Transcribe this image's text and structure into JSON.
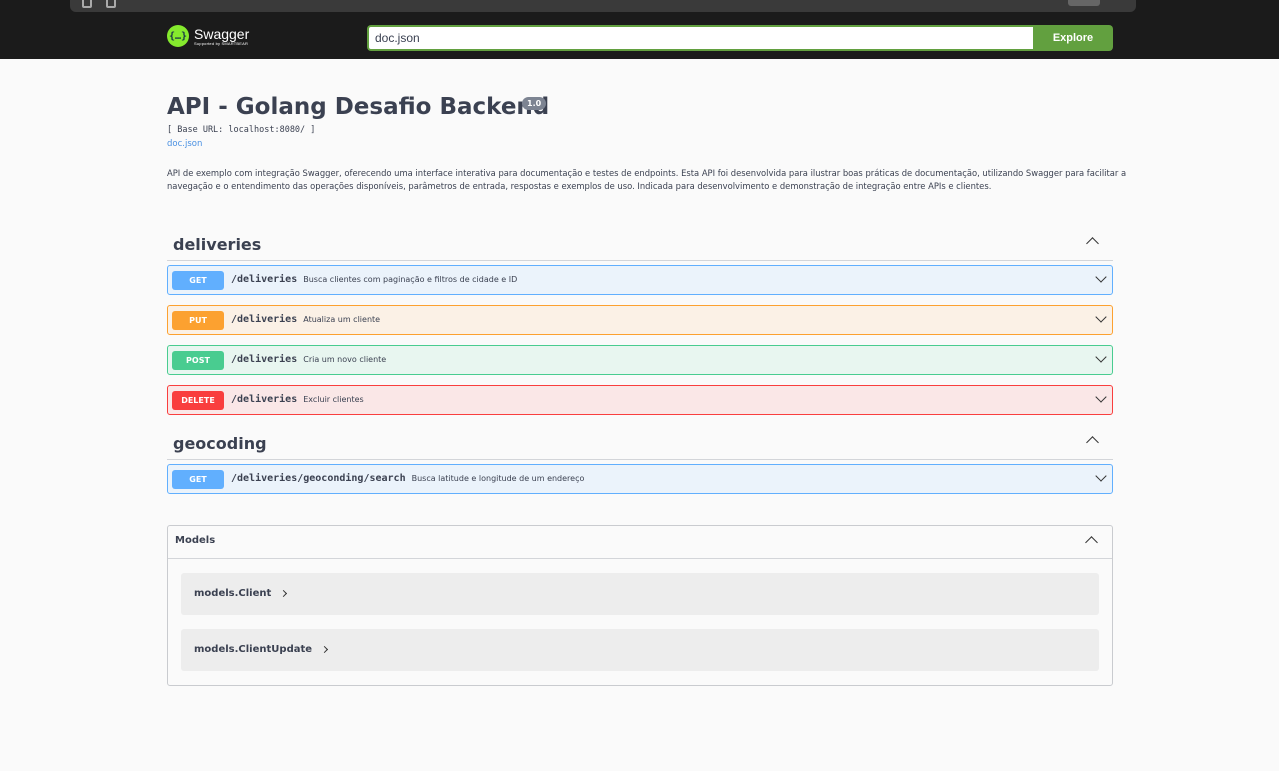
{
  "topbar": {
    "logo_name": "Swagger",
    "logo_sub": "Supported by SMARTBEAR",
    "url_value": "doc.json",
    "explore_label": "Explore"
  },
  "info": {
    "title": "API - Golang Desafio Backend",
    "version": "1.0",
    "base_url": "[ Base URL: localhost:8080/ ]",
    "doc_link": "doc.json",
    "description": "API de exemplo com integração Swagger, oferecendo uma interface interativa para documentação e testes de endpoints. Esta API foi desenvolvida para ilustrar boas práticas de documentação, utilizando Swagger para facilitar a navegação e o entendimento das operações disponíveis, parâmetros de entrada, respostas e exemplos de uso. Indicada para desenvolvimento e demonstração de integração entre APIs e clientes."
  },
  "sections": [
    {
      "title": "deliveries",
      "operations": [
        {
          "method": "GET",
          "path": "/deliveries",
          "summary": "Busca clientes com paginação e filtros de cidade e ID"
        },
        {
          "method": "PUT",
          "path": "/deliveries",
          "summary": "Atualiza um cliente"
        },
        {
          "method": "POST",
          "path": "/deliveries",
          "summary": "Cria um novo cliente"
        },
        {
          "method": "DELETE",
          "path": "/deliveries",
          "summary": "Excluir clientes"
        }
      ]
    },
    {
      "title": "geocoding",
      "operations": [
        {
          "method": "GET",
          "path": "/deliveries/geoconding/search",
          "summary": "Busca latitude e longitude de um endereço"
        }
      ]
    }
  ],
  "models": {
    "title": "Models",
    "items": [
      "models.Client",
      "models.ClientUpdate"
    ]
  },
  "colors": {
    "get": "#61affe",
    "put": "#fca130",
    "post": "#49cc90",
    "delete": "#f93e3e",
    "explore": "#62a03f",
    "logo": "#85ea2d"
  }
}
